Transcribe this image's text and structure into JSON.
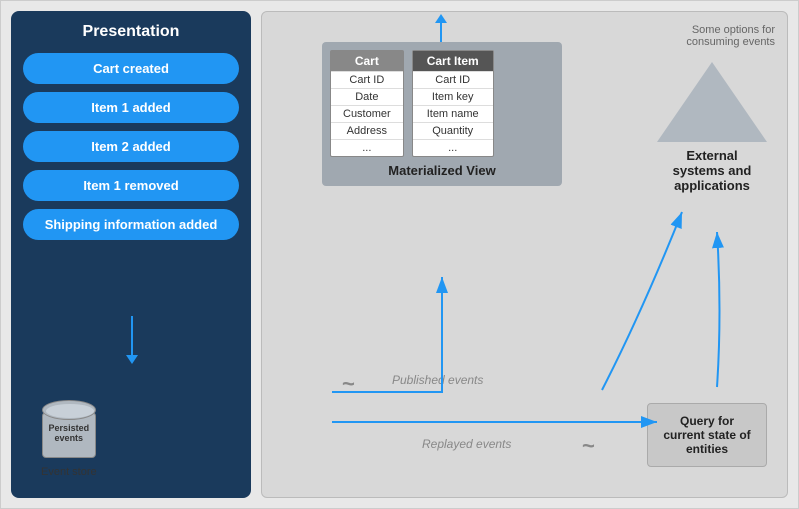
{
  "presentation": {
    "title": "Presentation",
    "events": [
      "Cart created",
      "Item 1 added",
      "Item 2 added",
      "Item 1 removed",
      "Shipping information added"
    ],
    "eventStoreLabel": "Event store",
    "eventStoreCylinderText": "Persisted\nevents"
  },
  "consumingLabel": "Some options for\nconsuming events",
  "materializedView": {
    "title": "Materialized View",
    "cartTable": {
      "header": "Cart",
      "rows": [
        "Cart ID",
        "Date",
        "Customer",
        "Address",
        "..."
      ]
    },
    "cartItemTable": {
      "header": "Cart Item",
      "rows": [
        "Cart ID",
        "Item key",
        "Item name",
        "Quantity",
        "..."
      ]
    }
  },
  "externalSystems": {
    "label": "External\nsystems and\napplications"
  },
  "queryBox": {
    "label": "Query for\ncurrent state\nof entities"
  },
  "labels": {
    "publishedEvents": "Published events",
    "replayedEvents": "Replayed events"
  }
}
